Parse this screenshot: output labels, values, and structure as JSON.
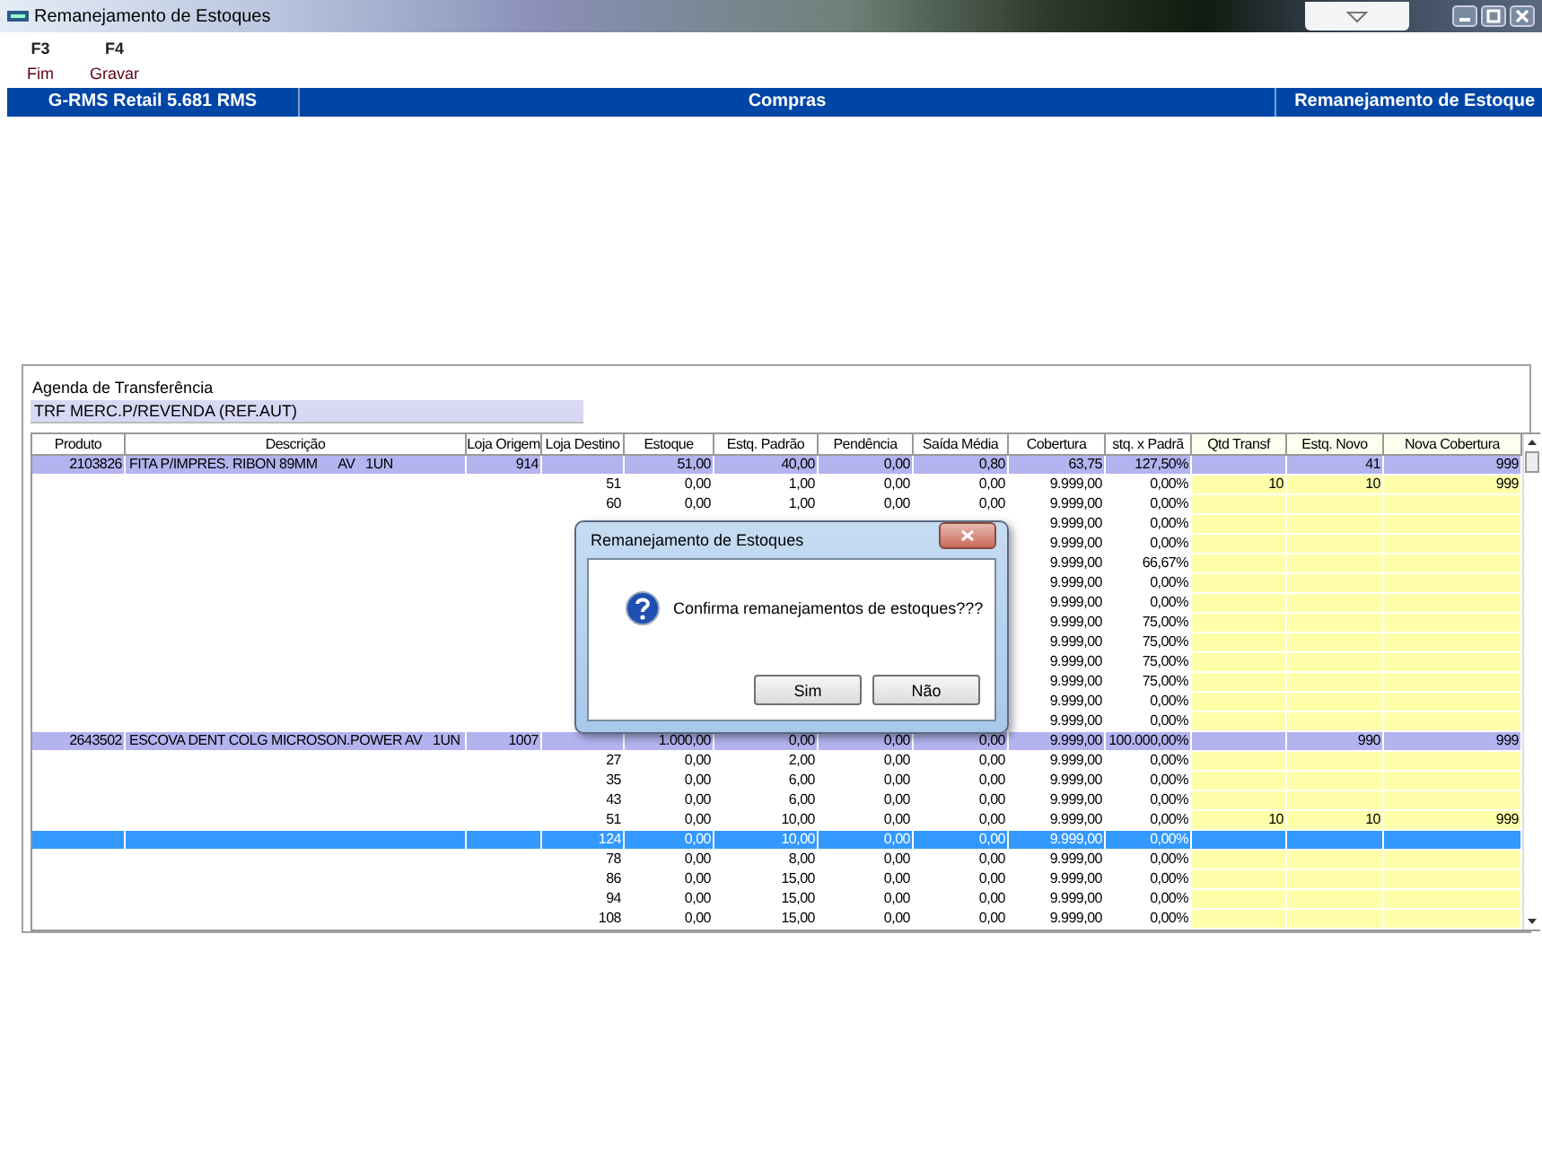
{
  "window": {
    "title": "Remanejamento de Estoques"
  },
  "function_keys": [
    {
      "key": "F3",
      "label": "Fim"
    },
    {
      "key": "F4",
      "label": "Gravar"
    }
  ],
  "header_bar": [
    "G-RMS Retail 5.681 RMS",
    "Compras",
    "Remanejamento de Estoque"
  ],
  "transfer_schedule": {
    "label": "Agenda de Transferência",
    "value": "TRF MERC.P/REVENDA (REF.AUT)"
  },
  "table": {
    "columns": [
      {
        "label": "Produto",
        "editable": false
      },
      {
        "label": "Descrição",
        "editable": false
      },
      {
        "label": "Loja Origem",
        "editable": false
      },
      {
        "label": "Loja Destino",
        "editable": false
      },
      {
        "label": "Estoque",
        "editable": false
      },
      {
        "label": "Estq. Padrão",
        "editable": false
      },
      {
        "label": "Pendência",
        "editable": false
      },
      {
        "label": "Saída Média",
        "editable": false
      },
      {
        "label": "Cobertura",
        "editable": false
      },
      {
        "label": "stq. x Padrã",
        "editable": false
      },
      {
        "label": "Qtd Transf",
        "editable": true
      },
      {
        "label": "Estq. Novo",
        "editable": true
      },
      {
        "label": "Nova Cobertura",
        "editable": true
      }
    ],
    "rows": [
      {
        "kind": "group",
        "selected": false,
        "cells": [
          "2103826",
          "FITA P/IMPRES. RIBON 89MM      AV   1UN",
          "914",
          null,
          "51,00",
          "40,00",
          "0,00",
          "0,80",
          "63,75",
          "127,50%",
          null,
          "41",
          "999"
        ]
      },
      {
        "kind": "detail",
        "selected": false,
        "cells": [
          null,
          null,
          null,
          "51",
          "0,00",
          "1,00",
          "0,00",
          "0,00",
          "9.999,00",
          "0,00%",
          "10",
          "10",
          "999"
        ]
      },
      {
        "kind": "detail",
        "selected": false,
        "cells": [
          null,
          null,
          null,
          "60",
          "0,00",
          "1,00",
          "0,00",
          "0,00",
          "9.999,00",
          "0,00%",
          null,
          null,
          null
        ]
      },
      {
        "kind": "detail",
        "selected": false,
        "cells": [
          null,
          null,
          null,
          null,
          null,
          null,
          null,
          null,
          "9.999,00",
          "0,00%",
          null,
          null,
          null
        ]
      },
      {
        "kind": "detail",
        "selected": false,
        "cells": [
          null,
          null,
          null,
          null,
          null,
          null,
          null,
          null,
          "9.999,00",
          "0,00%",
          null,
          null,
          null
        ]
      },
      {
        "kind": "detail",
        "selected": false,
        "cells": [
          null,
          null,
          null,
          null,
          null,
          null,
          null,
          null,
          "9.999,00",
          "66,67%",
          null,
          null,
          null
        ]
      },
      {
        "kind": "detail",
        "selected": false,
        "cells": [
          null,
          null,
          null,
          null,
          null,
          null,
          null,
          null,
          "9.999,00",
          "0,00%",
          null,
          null,
          null
        ]
      },
      {
        "kind": "detail",
        "selected": false,
        "cells": [
          null,
          null,
          null,
          null,
          null,
          null,
          null,
          null,
          "9.999,00",
          "0,00%",
          null,
          null,
          null
        ]
      },
      {
        "kind": "detail",
        "selected": false,
        "cells": [
          null,
          null,
          null,
          null,
          null,
          null,
          null,
          null,
          "9.999,00",
          "75,00%",
          null,
          null,
          null
        ]
      },
      {
        "kind": "detail",
        "selected": false,
        "cells": [
          null,
          null,
          null,
          null,
          null,
          null,
          null,
          null,
          "9.999,00",
          "75,00%",
          null,
          null,
          null
        ]
      },
      {
        "kind": "detail",
        "selected": false,
        "cells": [
          null,
          null,
          null,
          null,
          null,
          null,
          null,
          null,
          "9.999,00",
          "75,00%",
          null,
          null,
          null
        ]
      },
      {
        "kind": "detail",
        "selected": false,
        "cells": [
          null,
          null,
          null,
          null,
          null,
          null,
          null,
          null,
          "9.999,00",
          "75,00%",
          null,
          null,
          null
        ]
      },
      {
        "kind": "detail",
        "selected": false,
        "cells": [
          null,
          null,
          null,
          null,
          null,
          null,
          null,
          null,
          "9.999,00",
          "0,00%",
          null,
          null,
          null
        ]
      },
      {
        "kind": "detail",
        "selected": false,
        "cells": [
          null,
          null,
          null,
          null,
          null,
          null,
          null,
          null,
          "9.999,00",
          "0,00%",
          null,
          null,
          null
        ]
      },
      {
        "kind": "group",
        "selected": false,
        "cells": [
          "2643502",
          "ESCOVA DENT COLG MICROSON.POWER AV   1UN",
          "1007",
          null,
          "1.000,00",
          "0,00",
          "0,00",
          "0,00",
          "9.999,00",
          "100.000,00%",
          null,
          "990",
          "999"
        ]
      },
      {
        "kind": "detail",
        "selected": false,
        "cells": [
          null,
          null,
          null,
          "27",
          "0,00",
          "2,00",
          "0,00",
          "0,00",
          "9.999,00",
          "0,00%",
          null,
          null,
          null
        ]
      },
      {
        "kind": "detail",
        "selected": false,
        "cells": [
          null,
          null,
          null,
          "35",
          "0,00",
          "6,00",
          "0,00",
          "0,00",
          "9.999,00",
          "0,00%",
          null,
          null,
          null
        ]
      },
      {
        "kind": "detail",
        "selected": false,
        "cells": [
          null,
          null,
          null,
          "43",
          "0,00",
          "6,00",
          "0,00",
          "0,00",
          "9.999,00",
          "0,00%",
          null,
          null,
          null
        ]
      },
      {
        "kind": "detail",
        "selected": false,
        "cells": [
          null,
          null,
          null,
          "51",
          "0,00",
          "10,00",
          "0,00",
          "0,00",
          "9.999,00",
          "0,00%",
          "10",
          "10",
          "999"
        ]
      },
      {
        "kind": "detail",
        "selected": true,
        "cells": [
          null,
          null,
          null,
          "124",
          "0,00",
          "10,00",
          "0,00",
          "0,00",
          "9.999,00",
          "0,00%",
          null,
          null,
          null
        ]
      },
      {
        "kind": "detail",
        "selected": false,
        "cells": [
          null,
          null,
          null,
          "78",
          "0,00",
          "8,00",
          "0,00",
          "0,00",
          "9.999,00",
          "0,00%",
          null,
          null,
          null
        ]
      },
      {
        "kind": "detail",
        "selected": false,
        "cells": [
          null,
          null,
          null,
          "86",
          "0,00",
          "15,00",
          "0,00",
          "0,00",
          "9.999,00",
          "0,00%",
          null,
          null,
          null
        ]
      },
      {
        "kind": "detail",
        "selected": false,
        "cells": [
          null,
          null,
          null,
          "94",
          "0,00",
          "15,00",
          "0,00",
          "0,00",
          "9.999,00",
          "0,00%",
          null,
          null,
          null
        ]
      },
      {
        "kind": "detail",
        "selected": false,
        "cells": [
          null,
          null,
          null,
          "108",
          "0,00",
          "15,00",
          "0,00",
          "0,00",
          "9.999,00",
          "0,00%",
          null,
          null,
          null
        ]
      }
    ]
  },
  "dialog": {
    "title": "Remanejamento de Estoques",
    "message": "Confirma remanejamentos de estoques???",
    "buttons": [
      "Sim",
      "Não"
    ]
  }
}
